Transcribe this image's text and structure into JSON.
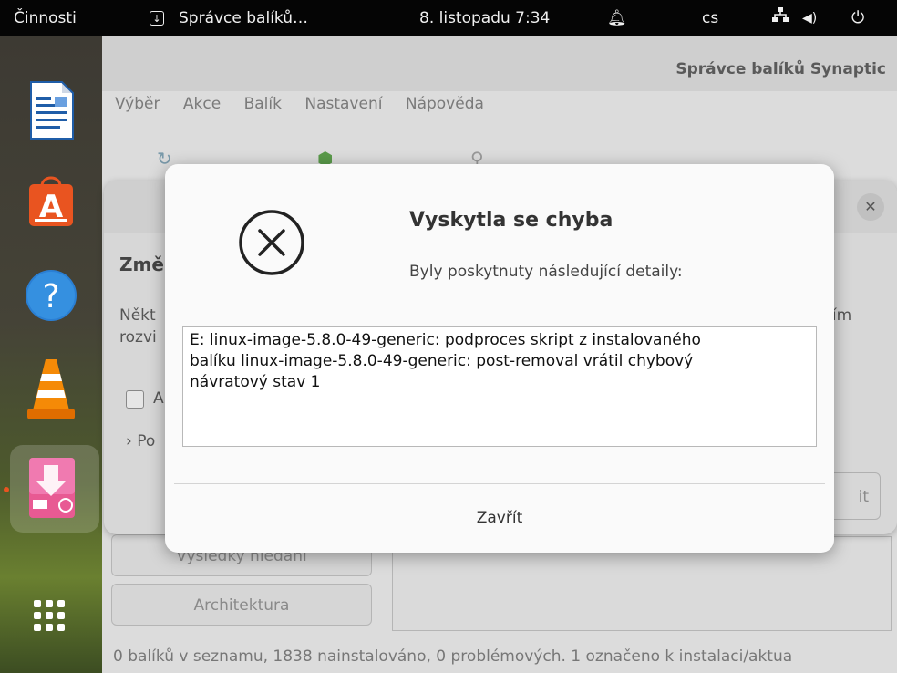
{
  "topbar": {
    "activities": "Činnosti",
    "app_title": "Správce balíků…",
    "datetime": "8. listopadu  7:34",
    "language": "cs",
    "icons": [
      "app-menu-icon",
      "alarm-bell-icon",
      "network-icon",
      "volume-icon",
      "power-icon"
    ]
  },
  "dock": {
    "apps": [
      "libreoffice-writer-icon",
      "ubuntu-software-icon",
      "help-icon",
      "vlc-icon",
      "synaptic-icon"
    ],
    "active_app": "synaptic-icon"
  },
  "synaptic": {
    "title": "Správce balíků Synaptic",
    "menu": [
      "Výběr",
      "Akce",
      "Balík",
      "Nastavení",
      "Nápověda"
    ],
    "left_buttons": [
      "Výsledky hledání",
      "Architektura"
    ],
    "status": "0 balíků v seznamu, 1838 nainstalováno, 0 problémových. 1 označeno k instalaci/aktua"
  },
  "back_dialog": {
    "heading": "Změ",
    "text_left": "Někt rozvi",
    "text_right": "sím",
    "checkbox_label": "A",
    "expander": "Po",
    "button": "it"
  },
  "error_dialog": {
    "title": "Vyskytla se chyba",
    "subtitle": "Byly poskytnuty následující detaily:",
    "details_lines": [
      "E: linux-image-5.8.0-49-generic: podproces skript z instalovaného",
      "balíku linux-image-5.8.0-49-generic: post-removal vrátil chybový",
      "návratový stav 1"
    ],
    "close_button": "Zavřít"
  },
  "colors": {
    "topbar_bg": "#050505",
    "dialog_bg": "#fafafa",
    "accent": "#e95420"
  }
}
